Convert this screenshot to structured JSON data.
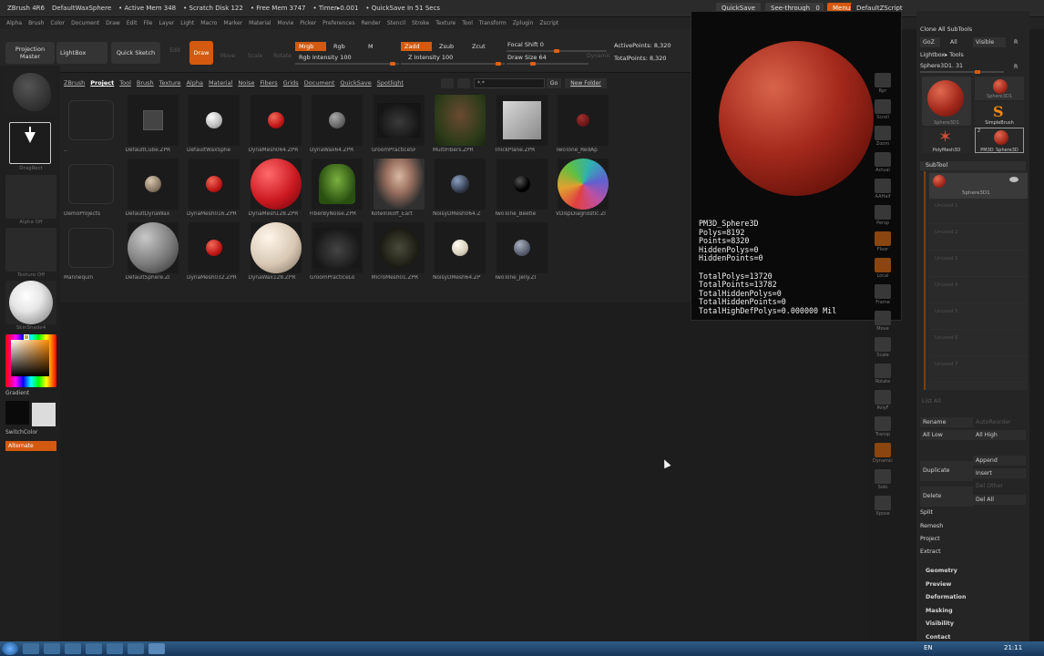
{
  "titlebar": {
    "app": "ZBrush 4R6",
    "doc": "DefaultWaxSphere",
    "active_mem": "• Active Mem 348",
    "scratch": "• Scratch Disk 122",
    "free_mem": "• Free Mem 3747",
    "timer": "• Timer▸0.001",
    "quicksave": "• QuickSave In 51 Secs",
    "btn_quicksave": "QuickSave",
    "btn_seethrough": "See-through",
    "seethrough_val": "0",
    "btn_menus": "Menus",
    "script": "DefaultZScript"
  },
  "menubar": [
    "Alpha",
    "Brush",
    "Color",
    "Document",
    "Draw",
    "Edit",
    "File",
    "Layer",
    "Light",
    "Macro",
    "Marker",
    "Material",
    "Movie",
    "Picker",
    "Preferences",
    "Render",
    "Stencil",
    "Stroke",
    "Texture",
    "Tool",
    "Transform",
    "Zplugin",
    "Zscript"
  ],
  "shelf": {
    "projection_master": "Projection Master",
    "lightbox": "LightBox",
    "quick_sketch": "Quick Sketch",
    "edit": "Edit",
    "draw": "Draw",
    "move": "Move",
    "scale": "Scale",
    "rotate": "Rotate",
    "mrgb": "Mrgb",
    "rgb": "Rgb",
    "m": "M",
    "rgb_intensity": "Rgb Intensity 100",
    "zadd": "Zadd",
    "zsub": "Zsub",
    "zcut": "Zcut",
    "z_intensity": "Z Intensity 100",
    "focal_shift": "Focal Shift 0",
    "draw_size": "Draw Size 64",
    "dynamic": "Dynamic",
    "active_points": "ActivePoints: 8,320",
    "total_points": "TotalPoints: 8,320"
  },
  "left": {
    "dragrect": "DragRect",
    "alpha_off": "Alpha Off",
    "texture_off": "Texture Off",
    "skinshade": "SkinShade4",
    "gradient": "Gradient",
    "switchcolor": "SwitchColor",
    "alternate": "Alternate"
  },
  "lightbox": {
    "tabs": [
      "ZBrush",
      "Project",
      "Tool",
      "Brush",
      "Texture",
      "Alpha",
      "Material",
      "Noise",
      "Fibers",
      "Grids",
      "Document",
      "QuickSave",
      "Spotlight"
    ],
    "search": "*.*",
    "go": "Go",
    "new_folder": "New Folder",
    "items": [
      {
        "label": "..",
        "kind": "folder"
      },
      {
        "label": "DefaultCube.ZPR",
        "kind": "cube"
      },
      {
        "label": "DefaultWaxSphe",
        "kind": "white"
      },
      {
        "label": "DynaMesh064.ZPR",
        "kind": "red"
      },
      {
        "label": "DynaWax64.ZPR",
        "kind": "grey"
      },
      {
        "label": "GroomPracticeSF",
        "kind": "dog"
      },
      {
        "label": "MultiFibers.ZPR",
        "kind": "fur"
      },
      {
        "label": "ThickPlane.ZPR",
        "kind": "plane"
      },
      {
        "label": "TwoTone_RedAp",
        "kind": "darkred"
      },
      {
        "label": "DemoProjects",
        "kind": "folder"
      },
      {
        "label": "DefaultDynaWax",
        "kind": "tan"
      },
      {
        "label": "DynaMesh016.ZPR",
        "kind": "red"
      },
      {
        "label": "DynaMesh128.ZPR",
        "kind": "bigred"
      },
      {
        "label": "FiberByNoise.ZPR",
        "kind": "grass"
      },
      {
        "label": "Kotelnikoff_Eart",
        "kind": "ogre"
      },
      {
        "label": "NoisyDMesh064.Z",
        "kind": "noisy"
      },
      {
        "label": "TwoTone_Beetle",
        "kind": "black"
      },
      {
        "label": "VDispDiagnostic.ZI",
        "kind": "rainbow"
      },
      {
        "label": "Mannequin",
        "kind": "folder"
      },
      {
        "label": "DefaultSphere.ZI",
        "kind": "bigsphere"
      },
      {
        "label": "DynaMesh032.ZPR",
        "kind": "red"
      },
      {
        "label": "DynaWax128.ZPR",
        "kind": "bigwhite"
      },
      {
        "label": "GroomPracticeLo",
        "kind": "dog2"
      },
      {
        "label": "MicroMesh01.ZPR",
        "kind": "bush"
      },
      {
        "label": "NoisyDMesh64.ZP",
        "kind": "cream"
      },
      {
        "label": "TwoTone_Jelly.ZI",
        "kind": "steel"
      }
    ]
  },
  "info": {
    "text": "PM3D_Sphere3D\nPolys=8192\nPoints=8320\nHiddenPolys=0\nHiddenPoints=0\n\nTotalPolys=13720\nTotalPoints=13782\nTotalHiddenPolys=0\nTotalHiddenPoints=0\nTotalHighDefPolys=0.000000 Mil"
  },
  "rstrip": [
    "Bpr",
    "Scroll",
    "Zoom",
    "Actual",
    "AAHalf",
    "Persp",
    "Floor",
    "Local",
    "Frame",
    "Move",
    "Scale",
    "Rotate",
    "PolyF",
    "Transp",
    "Dynamic",
    "Solo",
    "Xpose"
  ],
  "rpanel": {
    "clone_all": "Clone All SubTools",
    "goz": "GoZ",
    "all": "All",
    "visible": "Visible",
    "r": "R",
    "lightbox_tools": "Lightbox▸ Tools",
    "tool_name": "Sphere3D1. 31",
    "r2": "R",
    "tools": [
      "Sphere3D1",
      "Sphere3D1",
      "SimpleBrush",
      "PolyMesh3D",
      "PM3D_Sphere3D"
    ],
    "count": "2",
    "subtool": "SubTool",
    "sub_item": "Sphere3D1",
    "unused": [
      "Unused 1",
      "Unused 2",
      "Unused 3",
      "Unused 4",
      "Unused 5",
      "Unused 6",
      "Unused 7"
    ],
    "list_all": "List All",
    "rename": "Rename",
    "autoreorder": "AutoReorder",
    "all_low": "All Low",
    "all_high": "All High",
    "append": "Append",
    "duplicate": "Duplicate",
    "insert": "Insert",
    "del_other": "Del Other",
    "delete": "Delete",
    "del_all": "Del All",
    "split": "Split",
    "remesh": "Remesh",
    "project": "Project",
    "extract": "Extract",
    "sections": [
      "Geometry",
      "Preview",
      "Deformation",
      "Masking",
      "Visibility",
      "Contact"
    ]
  },
  "taskbar": {
    "lang": "EN",
    "clock": "21:11"
  },
  "colors": {
    "accent": "#d35a10",
    "sphere": "#a4291c"
  }
}
